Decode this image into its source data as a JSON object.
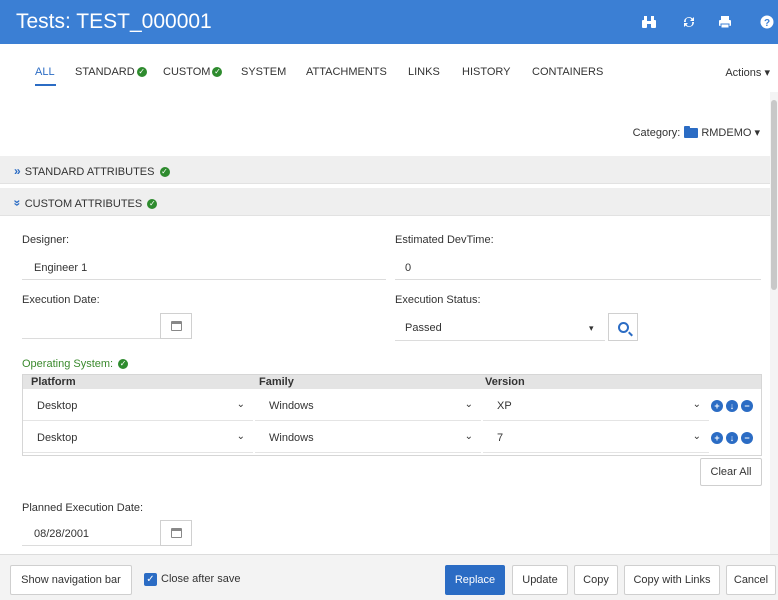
{
  "header": {
    "title": "Tests: TEST_000001",
    "icons": [
      "binoculars-icon",
      "refresh-icon",
      "print-icon",
      "help-icon"
    ]
  },
  "tabs": [
    {
      "label": "ALL",
      "active": true,
      "check": false
    },
    {
      "label": "STANDARD",
      "check": true
    },
    {
      "label": "CUSTOM",
      "check": true
    },
    {
      "label": "SYSTEM",
      "check": false
    },
    {
      "label": "ATTACHMENTS",
      "check": false
    },
    {
      "label": "LINKS",
      "check": false
    },
    {
      "label": "HISTORY",
      "check": false
    },
    {
      "label": "CONTAINERS",
      "check": false
    }
  ],
  "actions_label": "Actions ▾",
  "category": {
    "label": "Category:",
    "value": "RMDEMO ▾"
  },
  "sections": {
    "standard": "STANDARD ATTRIBUTES",
    "custom": "CUSTOM ATTRIBUTES"
  },
  "fields": {
    "designer": {
      "label": "Designer:",
      "value": "Engineer 1"
    },
    "estimated_devtime": {
      "label": "Estimated DevTime:",
      "value": "0"
    },
    "execution_date": {
      "label": "Execution Date:",
      "value": ""
    },
    "execution_status": {
      "label": "Execution Status:",
      "value": "Passed"
    },
    "planned_execution_date": {
      "label": "Planned Execution Date:",
      "value": "08/28/2001"
    }
  },
  "operating_system": {
    "label": "Operating System:",
    "columns": [
      "Platform",
      "Family",
      "Version"
    ],
    "rows": [
      {
        "platform": "Desktop",
        "family": "Windows",
        "version": "XP"
      },
      {
        "platform": "Desktop",
        "family": "Windows",
        "version": "7"
      }
    ],
    "clear_all": "Clear All"
  },
  "footer": {
    "show_nav": "Show navigation bar",
    "close_after_save": "Close after save",
    "close_after_save_checked": true,
    "replace": "Replace",
    "update": "Update",
    "copy": "Copy",
    "copy_with_links": "Copy with Links",
    "cancel": "Cancel"
  },
  "colors": {
    "header_bg": "#3b7fd4",
    "accent": "#2b6cc4",
    "check_green": "#2e8b2e"
  }
}
